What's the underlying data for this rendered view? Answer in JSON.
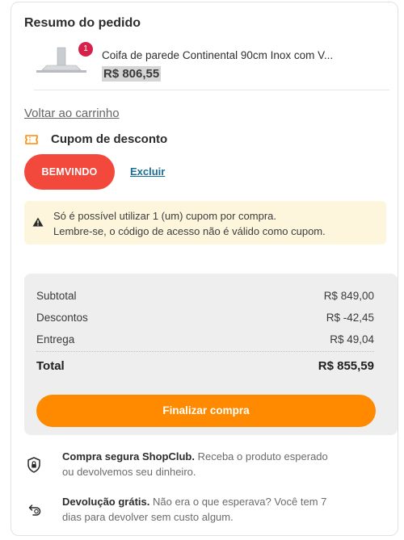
{
  "order_summary": {
    "title": "Resumo do pedido",
    "product": {
      "quantity": "1",
      "name": "Coifa de parede Continental 90cm Inox com V...",
      "price": "R$ 806,55"
    },
    "back_link": "Voltar ao carrinho"
  },
  "coupon": {
    "title": "Cupom de desconto",
    "code": "BEMVINDO",
    "remove_label": "Excluir",
    "notice_line1": "Só é possível utilizar 1 (um) cupom por compra.",
    "notice_line2": "Lembre-se, o código de acesso não é válido como cupom."
  },
  "totals": {
    "subtotal_label": "Subtotal",
    "subtotal_value": "R$ 849,00",
    "discount_label": "Descontos",
    "discount_value": "R$ -42,45",
    "shipping_label": "Entrega",
    "shipping_value": "R$ 49,04",
    "total_label": "Total",
    "total_value": "R$ 855,59",
    "checkout_label": "Finalizar compra"
  },
  "benefits": [
    {
      "title": "Compra segura ShopClub.",
      "text_line1": "Receba o produto esperado",
      "text_line2": "ou devolvemos seu dinheiro.",
      "icon": "shield-lock-icon"
    },
    {
      "title": "Devolução grátis.",
      "text_line1": "Não era o que esperava? Você tem 7",
      "text_line2": "dias para devolver sem custo algum.",
      "icon": "return-icon"
    }
  ],
  "colors": {
    "coupon_chip": "#f2493c",
    "checkout_button": "#ff8a00",
    "badge": "#d6224a",
    "notice_bg": "#fdf6dd",
    "link": "#1a6f99"
  }
}
